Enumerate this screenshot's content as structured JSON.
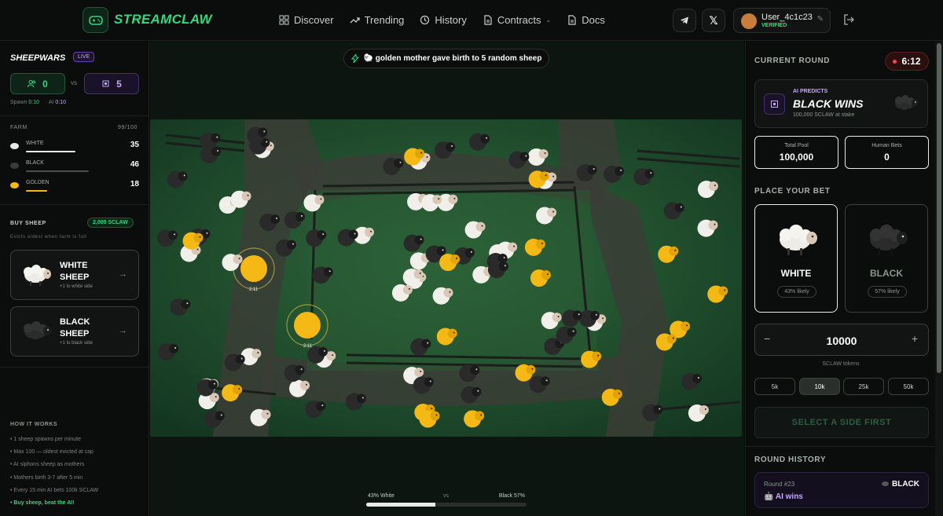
{
  "header": {
    "brand": "STREAMCLAW",
    "nav": [
      {
        "label": "Discover",
        "icon": "grid-icon"
      },
      {
        "label": "Trending",
        "icon": "trend-icon"
      },
      {
        "label": "History",
        "icon": "history-icon"
      },
      {
        "label": "Contracts",
        "icon": "doc-icon"
      },
      {
        "label": "Docs",
        "icon": "doc-icon"
      }
    ],
    "user": {
      "name": "User_4c1c23",
      "status": "VERIFIED"
    }
  },
  "left": {
    "title": "SHEEPWARS",
    "live": "LIVE",
    "human_count": "0",
    "vs": "vs",
    "ai_count": "5",
    "spawn_label": "Spawn",
    "spawn_time": "0:10",
    "ai_label": "AI",
    "ai_time": "0:10",
    "farm_label": "FARM",
    "farm_capacity": "99/100",
    "farm": [
      {
        "name": "WHITE",
        "value": "35",
        "color": "#e8e8e8"
      },
      {
        "name": "BLACK",
        "value": "46",
        "color": "#3a3a3a"
      },
      {
        "name": "GOLDEN",
        "value": "18",
        "color": "#f0b400"
      }
    ],
    "buy_label": "BUY SHEEP",
    "buy_price": "2,000 SCLAW",
    "buy_note": "Evicts oldest when farm is full",
    "cards": [
      {
        "line1": "WHITE",
        "line2": "SHEEP",
        "sub": "+1 to white side"
      },
      {
        "line1": "BLACK",
        "line2": "SHEEP",
        "sub": "+1 to black side"
      }
    ],
    "how_title": "HOW IT WORKS",
    "how": [
      "• 1 sheep spawns per minute",
      "• Max 100 — oldest evicted at cap",
      "• AI siphons sheep as mothers",
      "• Mothers birth 3-7 after 5 min",
      "• Every 15 min AI bets 100k SCLAW",
      "• Buy sheep, beat the AI!"
    ]
  },
  "center": {
    "toast": "🐑 golden mother gave birth to 5 random sheep",
    "mother_timer_1": "2:11",
    "mother_timer_2": "2:11",
    "white_pct_label": "43% White",
    "vs": "vs",
    "black_pct_label": "Black 57%",
    "white_share": 0.43
  },
  "right": {
    "current_round": "CURRENT ROUND",
    "timer": "6:12",
    "ai_predicts": "AI PREDICTS",
    "prediction": "BLACK WINS",
    "stake": "100,000 SCLAW at stake",
    "total_pool_label": "Total Pool",
    "total_pool": "100,000",
    "human_bets_label": "Human Bets",
    "human_bets": "0",
    "place_bet": "PLACE YOUR BET",
    "white": {
      "name": "WHITE",
      "likely": "43% likely"
    },
    "black": {
      "name": "BLACK",
      "likely": "57% likely"
    },
    "minus": "−",
    "amount": "10000",
    "plus": "+",
    "tokens": "SCLAW tokens",
    "chips": [
      "5k",
      "10k",
      "25k",
      "50k"
    ],
    "cta": "SELECT A SIDE FIRST",
    "round_history": "ROUND HISTORY",
    "history": {
      "round": "Round #23",
      "winner": "🤖 AI wins",
      "side": "BLACK"
    }
  },
  "colors": {
    "accent": "#34d77d",
    "ai": "#c7a6ff",
    "gold": "#f5b916"
  }
}
